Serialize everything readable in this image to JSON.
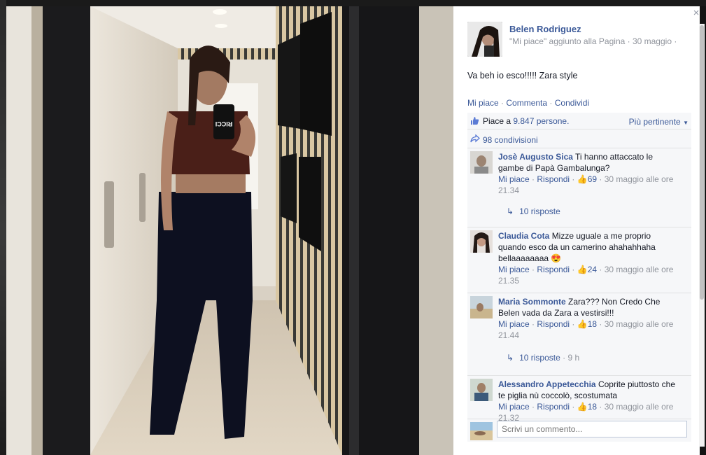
{
  "post": {
    "page_name": "Belen Rodriguez",
    "subtitle": "\"Mi piace\" aggiunto alla Pagina · 30 maggio ·",
    "text": "Va beh io esco!!!!! Zara style",
    "actions": {
      "like": "Mi piace",
      "comment": "Commenta",
      "share": "Condividi"
    },
    "phone_case_text": "RICCI"
  },
  "feedback": {
    "likes_prefix": "Piace a",
    "likes_count": "9.847 persone.",
    "sort_label": "Più pertinente",
    "shares": "98 condivisioni"
  },
  "comments": [
    {
      "author": "Josè Augusto Sica",
      "text_line1": "Ti hanno attaccato le",
      "text_line2": "gambe di Papà Gambalunga?",
      "text_line3": "",
      "like_label": "Mi piace",
      "reply_label": "Rispondi",
      "like_count": "69",
      "time_line1": "30 maggio alle ore",
      "time_line2": "21.34",
      "replies": "10 risposte",
      "replies_time": ""
    },
    {
      "author": "Claudia Cota",
      "text_line1": "Mizze uguale a me proprio",
      "text_line2": "quando esco da un camerino ahahahhaha",
      "text_line3": "bellaaaaaaaa 😍",
      "like_label": "Mi piace",
      "reply_label": "Rispondi",
      "like_count": "24",
      "time_line1": "30 maggio alle ore",
      "time_line2": "21.35"
    },
    {
      "author": "Maria Sommonte",
      "text_line1": "Zara??? Non Credo Che",
      "text_line2": "Belen vada da Zara a vestirsi!!!",
      "text_line3": "",
      "like_label": "Mi piace",
      "reply_label": "Rispondi",
      "like_count": "18",
      "time_line1": "30 maggio alle ore",
      "time_line2": "21.44",
      "replies": "10 risposte",
      "replies_time": "· 9 h"
    },
    {
      "author": "Alessandro Appetecchia",
      "text_line1": "Coprite piuttosto che",
      "text_line2": "te piglia nù coccolò, scostumata",
      "text_line3": "",
      "like_label": "Mi piace",
      "reply_label": "Rispondi",
      "like_count": "18",
      "time_line1": "30 maggio alle ore",
      "time_line2": "21.32"
    }
  ],
  "write_comment": {
    "placeholder": "Scrivi un commento..."
  },
  "close_glyph": "×",
  "colors": {
    "link": "#3b5998",
    "meta": "#90949c",
    "feedback_bg": "#f6f7f9"
  }
}
